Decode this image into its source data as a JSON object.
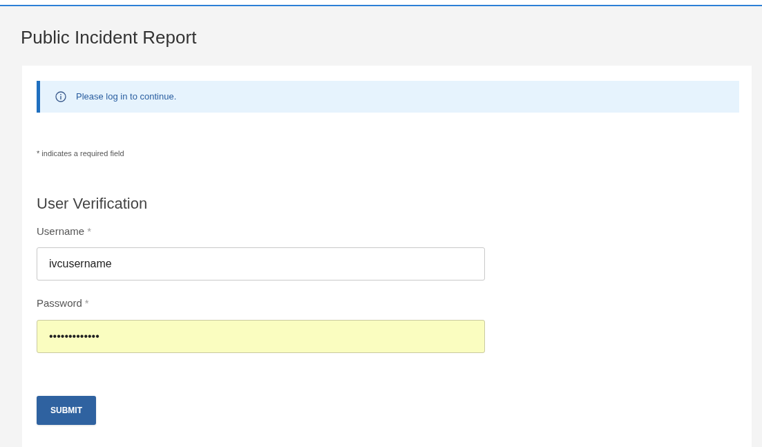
{
  "page_title": "Public Incident Report",
  "alert": {
    "kind": "info",
    "text": "Please log in to continue."
  },
  "required_note": "* indicates a required field",
  "section_title": "User Verification",
  "fields": [
    {
      "label": "Username",
      "required_mark": "*",
      "value": "ivcusername",
      "autofilled": false
    },
    {
      "label": "Password",
      "required_mark": "*",
      "value": "•••••••••••••",
      "autofilled": true
    }
  ],
  "submit_button": "SUBMIT"
}
